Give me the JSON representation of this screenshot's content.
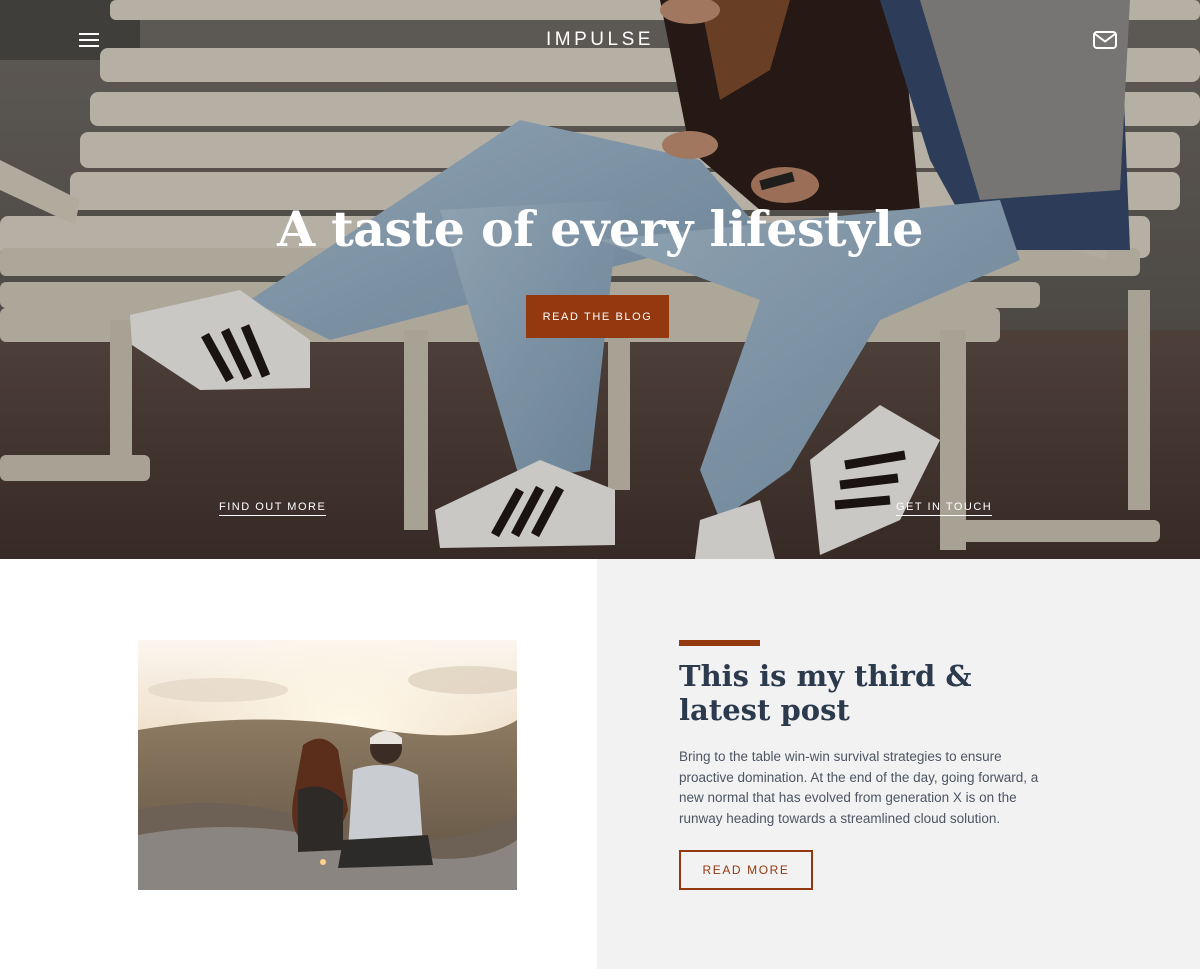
{
  "brand": {
    "name": "IMPULSE"
  },
  "nav": {
    "menu_icon": "hamburger-menu-icon",
    "mail_icon": "mail-envelope-icon"
  },
  "hero": {
    "title": "A taste of every lifestyle",
    "cta_label": "READ THE BLOG",
    "left_link": "FIND OUT MORE",
    "right_link": "GET IN TOUCH",
    "image_alt": "Couple sitting on a white park bench wearing jeans and sneakers"
  },
  "post": {
    "title": "This is my third & latest post",
    "excerpt": "Bring to the table win-win survival strategies to ensure proactive domination. At the end of the day, going forward, a new normal that has evolved from generation X is on the runway heading towards a streamlined cloud solution.",
    "button_label": "READ MORE",
    "image_alt": "Couple sitting on rocks watching the sunset"
  },
  "colors": {
    "accent": "#93380f",
    "post_panel_bg": "#f2f2f3",
    "heading": "#2c3a4e",
    "body_text": "#4d5562"
  }
}
